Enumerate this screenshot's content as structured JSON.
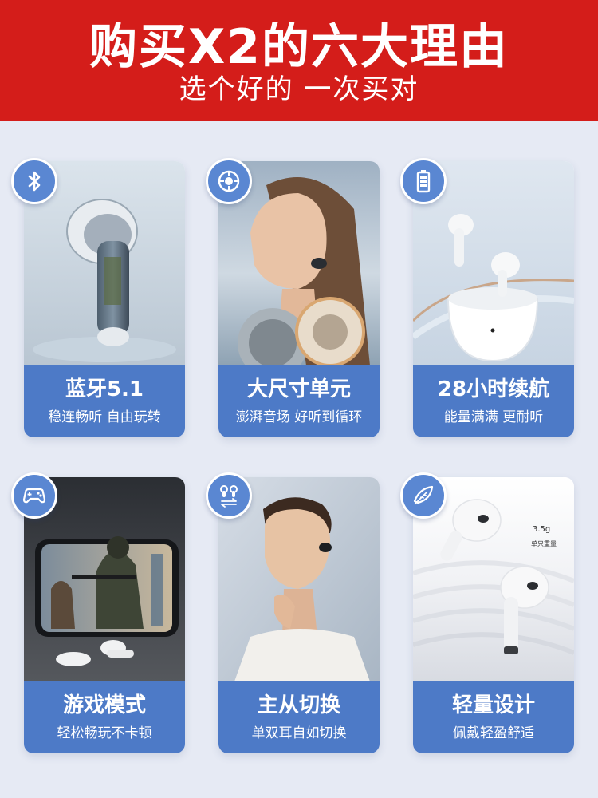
{
  "banner": {
    "title": "购买X2的六大理由",
    "subtitle": "选个好的 一次买对"
  },
  "colors": {
    "banner_red": "#d41d1a",
    "card_blue": "#4d7ac7",
    "badge_blue": "#5a87d2",
    "page_bg": "#e6eaf4"
  },
  "features": [
    {
      "icon": "bluetooth-icon",
      "title": "蓝牙5.1",
      "subtitle": "稳连畅听 自由玩转"
    },
    {
      "icon": "speaker-driver-icon",
      "title": "大尺寸单元",
      "subtitle": "澎湃音场 好听到循环"
    },
    {
      "icon": "battery-icon",
      "title": "28小时续航",
      "subtitle": "能量满满 更耐听"
    },
    {
      "icon": "gamepad-icon",
      "title": "游戏模式",
      "subtitle": "轻松畅玩不卡顿"
    },
    {
      "icon": "earbuds-switch-icon",
      "title": "主从切换",
      "subtitle": "单双耳自如切换"
    },
    {
      "icon": "feather-icon",
      "title": "轻量设计",
      "subtitle": "佩戴轻盈舒适"
    }
  ],
  "weight_label": {
    "value": "3.5g",
    "caption": "单只重量"
  }
}
